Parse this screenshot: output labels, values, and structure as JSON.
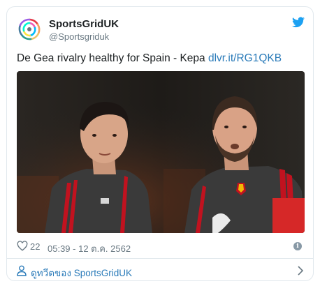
{
  "tweet": {
    "author_name": "SportsGridUK",
    "author_handle": "@Sportsgriduk",
    "text": "De Gea rivalry healthy for Spain - Kepa ",
    "link": "dlvr.it/RG1QKB",
    "like_count": "22",
    "timestamp": "05:39 - 12 ต.ค. 2562",
    "info_glyph": "i"
  },
  "footer": {
    "view_profile_label": "ดูทวีตของ SportsGridUK"
  },
  "colors": {
    "link": "#2b7bb9",
    "twitter_blue": "#1da1f2",
    "muted": "#697882",
    "border": "#e1e8ed",
    "jersey": "#3a3a3a",
    "jersey_stripe": "#c1121f"
  },
  "icons": [
    "avatar-logo",
    "twitter-bird-icon",
    "heart-icon",
    "info-icon",
    "person-icon",
    "chevron-right-icon"
  ]
}
